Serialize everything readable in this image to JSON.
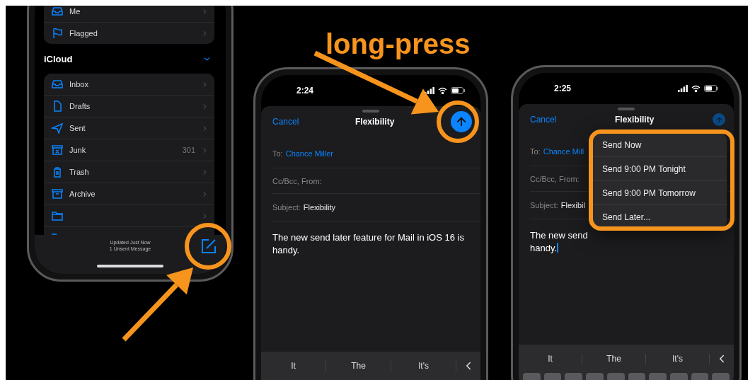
{
  "annotation": {
    "label": "long-press"
  },
  "mailbox_phone": {
    "favorites": [
      {
        "kind": "inbox",
        "label": "Me"
      },
      {
        "kind": "flag",
        "label": "Flagged"
      }
    ],
    "account": {
      "title": "iCloud",
      "expanded": true
    },
    "mailboxes": [
      {
        "kind": "inbox",
        "label": "Inbox"
      },
      {
        "kind": "drafts",
        "label": "Drafts"
      },
      {
        "kind": "sent",
        "label": "Sent"
      },
      {
        "kind": "junk",
        "label": "Junk",
        "count": "301"
      },
      {
        "kind": "trash",
        "label": "Trash"
      },
      {
        "kind": "archive",
        "label": "Archive"
      },
      {
        "kind": "folder"
      },
      {
        "kind": "folder"
      }
    ],
    "status_lines": [
      "Updated Just Now",
      "1 Unsent Message"
    ]
  },
  "compose_phone": {
    "time": "2:24",
    "cancel": "Cancel",
    "title": "Flexibility",
    "send_dimmed": false,
    "to_label": "To:",
    "to": "Chance Miller",
    "cc_label": "Cc/Bcc, From:",
    "subject_label": "Subject:",
    "subject": "Flexibility",
    "body_lines": [
      "The new send later feature for Mail in iOS 16 is handy."
    ],
    "suggestions": [
      "It",
      "The",
      "It's"
    ]
  },
  "menu_phone": {
    "time": "2:25",
    "cancel": "Cancel",
    "title": "Flexibility",
    "send_dimmed": true,
    "to_label": "To:",
    "to": "Chance Mill",
    "cc_label": "Cc/Bcc, From:",
    "subject_label": "Subject:",
    "subject": "Flexibil",
    "body_lines": [
      "The new send",
      "handy."
    ],
    "caret": true,
    "suggestions": [
      "It",
      "The",
      "It's"
    ],
    "menu": [
      {
        "label": "Send Now"
      },
      {
        "label": "Send 9:00 PM Tonight"
      },
      {
        "label": "Send 9:00 PM Tomorrow"
      },
      {
        "label": "Send Later..."
      }
    ]
  }
}
